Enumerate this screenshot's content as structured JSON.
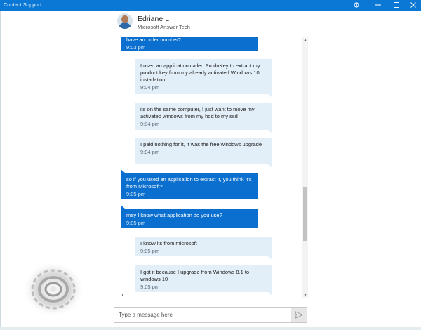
{
  "window": {
    "title": "Contact Support"
  },
  "agent": {
    "name": "Edriane L",
    "role": "Microsoft Answer Tech"
  },
  "messages": [
    {
      "sender": "agent",
      "text": "have an order number?",
      "time": "9:03 pm"
    },
    {
      "sender": "user",
      "text": "I used an application called ProduKey to extract my product key from my already activated Windows 10 installation",
      "time": "9:04 pm"
    },
    {
      "sender": "user",
      "text": "its on the same computer, I just want to move my activated windows from my hdd to my ssd",
      "time": "9:04 pm"
    },
    {
      "sender": "user",
      "text": "I paid nothing for it, it was the free windows upgrade",
      "time": "9:04 pm"
    },
    {
      "sender": "agent",
      "text": "so if you used an application to extract it, you think it's from Microsoft?",
      "time": "9:05 pm"
    },
    {
      "sender": "agent",
      "text": "may I know what application do you use?",
      "time": "9:05 pm"
    },
    {
      "sender": "user",
      "text": "I know its from microsoft",
      "time": "9:05 pm"
    },
    {
      "sender": "user",
      "text": "I got it because I upgrade from Windows 8.1 to windows 10",
      "time": "9:05 pm"
    }
  ],
  "composer": {
    "placeholder": "Type a message here",
    "value": ""
  },
  "colors": {
    "accent": "#0a78d4",
    "agent_bubble": "#0a6fce",
    "user_bubble": "#e2eef8"
  }
}
